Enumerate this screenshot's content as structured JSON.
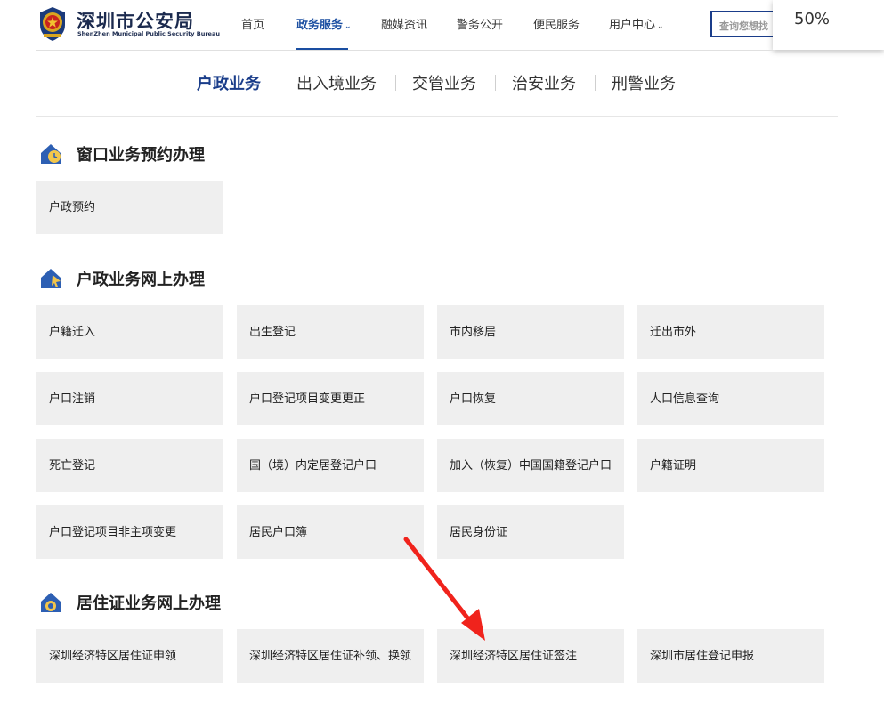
{
  "header": {
    "logo_title": "深圳市公安局",
    "logo_subtitle": "ShenZhen Municipal Public Security Bureau",
    "nav": [
      {
        "label": "首页"
      },
      {
        "label": "政务服务"
      },
      {
        "label": "融媒资讯"
      },
      {
        "label": "警务公开"
      },
      {
        "label": "便民服务"
      },
      {
        "label": "用户中心"
      }
    ],
    "search_placeholder": "查询您想找",
    "zoom_level": "50%"
  },
  "categories": [
    {
      "label": "户政业务"
    },
    {
      "label": "出入境业务"
    },
    {
      "label": "交管业务"
    },
    {
      "label": "治安业务"
    },
    {
      "label": "刑警业务"
    }
  ],
  "sections": [
    {
      "title": "窗口业务预约办理",
      "icon": "clock-house-icon",
      "items": [
        "户政预约"
      ]
    },
    {
      "title": "户政业务网上办理",
      "icon": "house-cursor-icon",
      "items": [
        "户籍迁入",
        "出生登记",
        "市内移居",
        "迁出市外",
        "户口注销",
        "户口登记项目变更更正",
        "户口恢复",
        "人口信息查询",
        "死亡登记",
        "国（境）内定居登记户口",
        "加入（恢复）中国国籍登记户口",
        "户籍证明",
        "户口登记项目非主项变更",
        "居民户口簿",
        "居民身份证"
      ]
    },
    {
      "title": "居住证业务网上办理",
      "icon": "house-card-icon",
      "items": [
        "深圳经济特区居住证申领",
        "深圳经济特区居住证补领、换领",
        "深圳经济特区居住证签注",
        "深圳市居住登记申报"
      ]
    }
  ],
  "colors": {
    "accent": "#1a4ea1",
    "card_bg": "#efefef",
    "arrow": "#f0231c"
  }
}
